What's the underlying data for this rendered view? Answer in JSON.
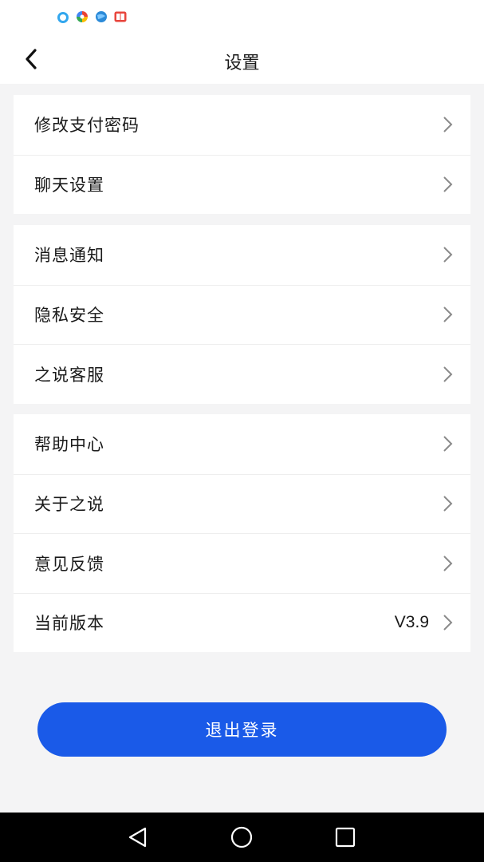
{
  "status_bar": {
    "icons": [
      "cloud-app-icon",
      "colorful-app-icon",
      "globe-app-icon",
      "book-app-icon"
    ]
  },
  "header": {
    "title": "设置",
    "back_icon": "chevron-left-icon"
  },
  "groups": [
    {
      "items": [
        {
          "label": "修改支付密码"
        },
        {
          "label": "聊天设置"
        }
      ]
    },
    {
      "items": [
        {
          "label": "消息通知"
        },
        {
          "label": "隐私安全"
        },
        {
          "label": "之说客服"
        }
      ]
    },
    {
      "items": [
        {
          "label": "帮助中心"
        },
        {
          "label": "关于之说"
        },
        {
          "label": "意见反馈"
        },
        {
          "label": "当前版本",
          "value": "V3.9"
        }
      ]
    }
  ],
  "logout": {
    "label": "退出登录",
    "color": "#1a5ae8"
  },
  "nav_bar": {
    "icons": [
      "back-triangle-icon",
      "home-circle-icon",
      "recents-square-icon"
    ]
  }
}
